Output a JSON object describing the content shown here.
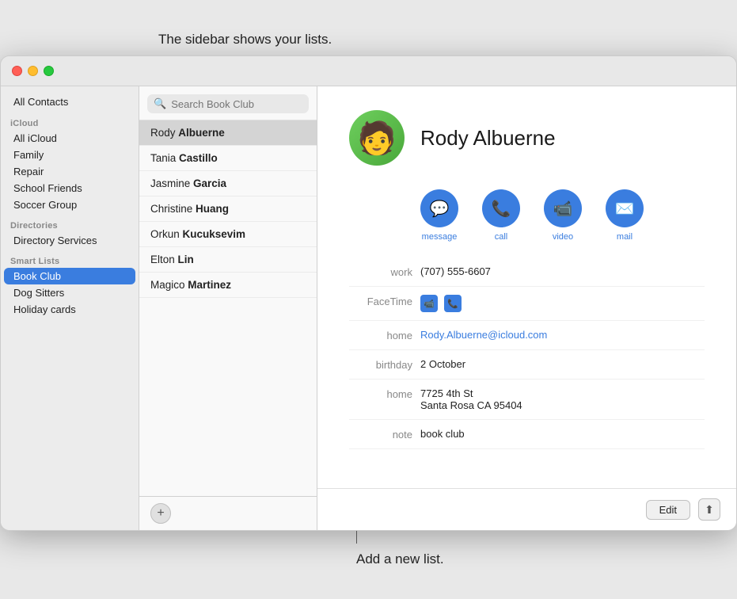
{
  "annotation_top": "The sidebar shows your lists.",
  "annotation_bottom": "Add a new list.",
  "titlebar": {
    "traffic_lights": [
      "red",
      "yellow",
      "green"
    ]
  },
  "sidebar": {
    "all_contacts_label": "All Contacts",
    "sections": [
      {
        "header": "iCloud",
        "items": [
          {
            "label": "All iCloud",
            "selected": false
          },
          {
            "label": "Family",
            "selected": false
          },
          {
            "label": "Repair",
            "selected": false
          },
          {
            "label": "School Friends",
            "selected": false
          },
          {
            "label": "Soccer Group",
            "selected": false
          }
        ]
      },
      {
        "header": "Directories",
        "items": [
          {
            "label": "Directory Services",
            "selected": false
          }
        ]
      },
      {
        "header": "Smart Lists",
        "items": [
          {
            "label": "Book Club",
            "selected": true
          },
          {
            "label": "Dog Sitters",
            "selected": false
          },
          {
            "label": "Holiday cards",
            "selected": false
          }
        ]
      }
    ]
  },
  "contact_list": {
    "search_placeholder": "Search Book Club",
    "contacts": [
      {
        "first": "Rody",
        "last": "Albuerne",
        "selected": true
      },
      {
        "first": "Tania",
        "last": "Castillo",
        "selected": false
      },
      {
        "first": "Jasmine",
        "last": "Garcia",
        "selected": false
      },
      {
        "first": "Christine",
        "last": "Huang",
        "selected": false
      },
      {
        "first": "Orkun",
        "last": "Kucuksevim",
        "selected": false
      },
      {
        "first": "Elton",
        "last": "Lin",
        "selected": false
      },
      {
        "first": "Magico",
        "last": "Martinez",
        "selected": false
      }
    ],
    "add_button_label": "+"
  },
  "detail": {
    "contact_name": "Rody Albuerne",
    "avatar_emoji": "🧑",
    "actions": [
      {
        "label": "message",
        "icon": "💬"
      },
      {
        "label": "call",
        "icon": "📞"
      },
      {
        "label": "video",
        "icon": "📹"
      },
      {
        "label": "mail",
        "icon": "✉️"
      }
    ],
    "fields": [
      {
        "label": "work",
        "value": "(707) 555-6607",
        "type": "phone"
      },
      {
        "label": "FaceTime",
        "value": "facetime",
        "type": "facetime"
      },
      {
        "label": "home",
        "value": "Rody.Albuerne@icloud.com",
        "type": "email"
      },
      {
        "label": "birthday",
        "value": "2 October",
        "type": "text"
      },
      {
        "label": "home",
        "value": "7725 4th St\nSanta Rosa CA 95404",
        "type": "address"
      },
      {
        "label": "note",
        "value": "book club",
        "type": "text"
      }
    ],
    "edit_button": "Edit",
    "share_button": "⬆"
  }
}
